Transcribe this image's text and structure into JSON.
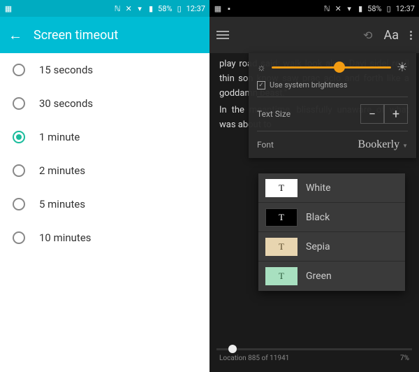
{
  "statusbar": {
    "battery": "58%",
    "time": "12:37"
  },
  "left": {
    "title": "Screen timeout",
    "options": [
      {
        "label": "15 seconds",
        "selected": false
      },
      {
        "label": "30 seconds",
        "selected": false
      },
      {
        "label": "1 minute",
        "selected": true
      },
      {
        "label": "2 minutes",
        "selected": false
      },
      {
        "label": "5 minutes",
        "selected": false
      },
      {
        "label": "10 minutes",
        "selected": false
      }
    ]
  },
  "right": {
    "header": {
      "aa_label": "Aa"
    },
    "book_text": "play road said: walk look almo Davi sidel reall thin son know saw prac aclo and forth like a goddamn beast.\"\n    In the meantime, blissfully unaware of what was about to",
    "settings": {
      "system_brightness_label": "Use system brightness",
      "system_brightness_checked": true,
      "text_size_label": "Text Size",
      "minus": "−",
      "plus": "+",
      "font_label": "Font",
      "font_value": "Bookerly"
    },
    "themes": [
      {
        "swatch_letter": "T",
        "label": "White",
        "class": "white"
      },
      {
        "swatch_letter": "T",
        "label": "Black",
        "class": "black"
      },
      {
        "swatch_letter": "T",
        "label": "Sepia",
        "class": "sepia"
      },
      {
        "swatch_letter": "T",
        "label": "Green",
        "class": "green"
      }
    ],
    "footer": {
      "location": "Location 885 of 11941",
      "percent": "7%"
    }
  }
}
